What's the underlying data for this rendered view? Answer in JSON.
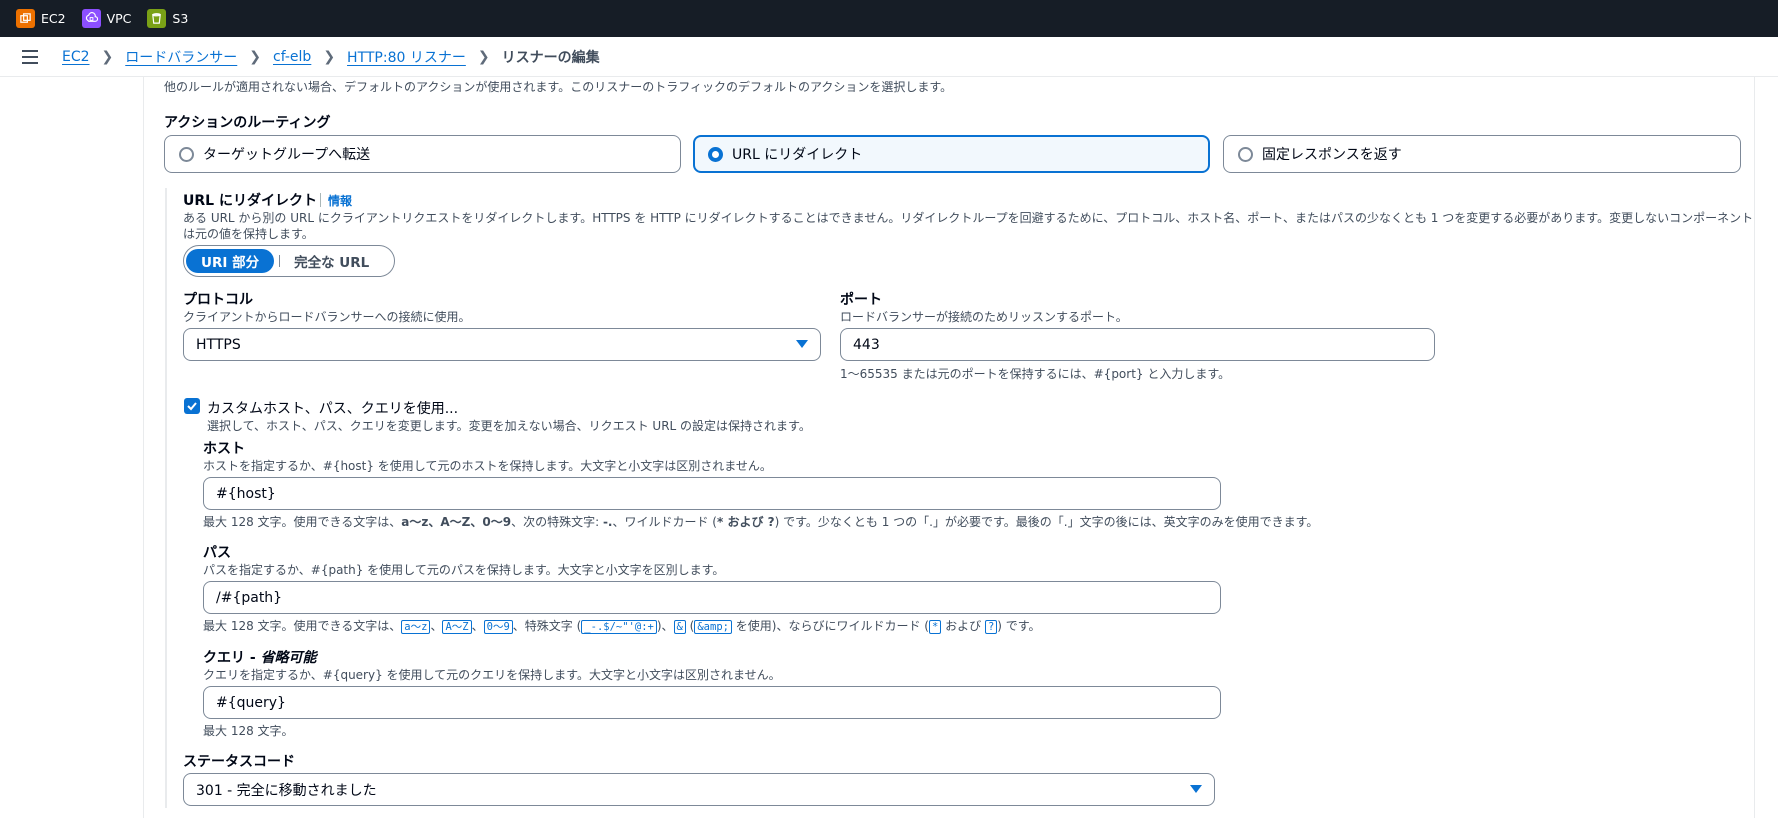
{
  "favorites": [
    {
      "label": "EC2",
      "icon": "ec2-icon",
      "color": "#ed7100"
    },
    {
      "label": "VPC",
      "icon": "vpc-icon",
      "color": "#8c4fff"
    },
    {
      "label": "S3",
      "icon": "s3-icon",
      "color": "#7aa116"
    }
  ],
  "breadcrumb": {
    "items": [
      "EC2",
      "ロードバランサー",
      "cf-elb",
      "HTTP:80 リスナー"
    ],
    "current": "リスナーの編集"
  },
  "default_action_desc": "他のルールが適用されない場合、デフォルトのアクションが使用されます。このリスナーのトラフィックのデフォルトのアクションを選択します。",
  "routing": {
    "label": "アクションのルーティング",
    "options": [
      "ターゲットグループへ転送",
      "URL にリダイレクト",
      "固定レスポンスを返す"
    ],
    "selected": "URL にリダイレクト"
  },
  "redirect": {
    "title": "URL にリダイレクト",
    "info": "情報",
    "desc_line1": "ある URL から別の URL にクライアントリクエストをリダイレクトします。HTTPS を HTTP にリダイレクトすることはできません。リダイレクトループを回避するために、プロトコル、ホスト名、ポート、またはパスの少なくとも 1 つを変更する必要があります。変更しないコンポーネント",
    "desc_line2": "は元の値を保持します。",
    "segments": [
      "URI 部分",
      "完全な URL"
    ]
  },
  "protocol": {
    "label": "プロトコル",
    "desc": "クライアントからロードバランサーへの接続に使用。",
    "value": "HTTPS"
  },
  "port": {
    "label": "ポート",
    "desc": "ロードバランサーが接続のためリッスンするポート。",
    "value": "443",
    "hint": "1〜65535 または元のポートを保持するには、#{port} と入力します。"
  },
  "custom": {
    "label": "カスタムホスト、パス、クエリを使用...",
    "desc": "選択して、ホスト、パス、クエリを変更します。変更を加えない場合、リクエスト URL の設定は保持されます。",
    "checked": true
  },
  "host": {
    "label": "ホスト",
    "desc": "ホストを指定するか、#{host} を使用して元のホストを保持します。大文字と小文字は区別されません。",
    "value": "#{host}",
    "hint_a": "最大 128 文字。使用できる文字は、",
    "hint_b": "a〜z、A〜Z、0〜9",
    "hint_c": "、次の特殊文字: ",
    "hint_d": "-.",
    "hint_e": "、ワイルドカード (",
    "hint_f": "* および ?",
    "hint_g": ") です。少なくとも 1 つの「.」が必要です。最後の「.」文字の後には、英文字のみを使用できます。"
  },
  "path": {
    "label": "パス",
    "desc": "パスを指定するか、#{path} を使用して元のパスを保持します。大文字と小文字を区別します。",
    "value": "/#{path}",
    "hint_a": "最大 128 文字。使用できる文字は、",
    "code1": "a〜z",
    "sep1": "、",
    "code2": "A〜Z",
    "sep2": "、",
    "code3": "0〜9",
    "hint_b": "、特殊文字 (",
    "code4": "_-.$/~\"'@:+",
    "hint_c": ")、",
    "code5": "&",
    "hint_d": " (",
    "code6": "&amp;",
    "hint_e": " を使用)、ならびにワイルドカード (",
    "code7": "*",
    "hint_f": " および ",
    "code8": "?",
    "hint_g": ") です。"
  },
  "query": {
    "label": "クエリ - ",
    "optional": "省略可能",
    "desc": "クエリを指定するか、#{query} を使用して元のクエリを保持します。大文字と小文字は区別されません。",
    "value": "#{query}",
    "hint": "最大 128 文字。"
  },
  "status": {
    "label": "ステータスコード",
    "value": "301 - 完全に移動されました"
  },
  "colors": {
    "accent": "#0972d3",
    "topbar": "#161d26"
  }
}
